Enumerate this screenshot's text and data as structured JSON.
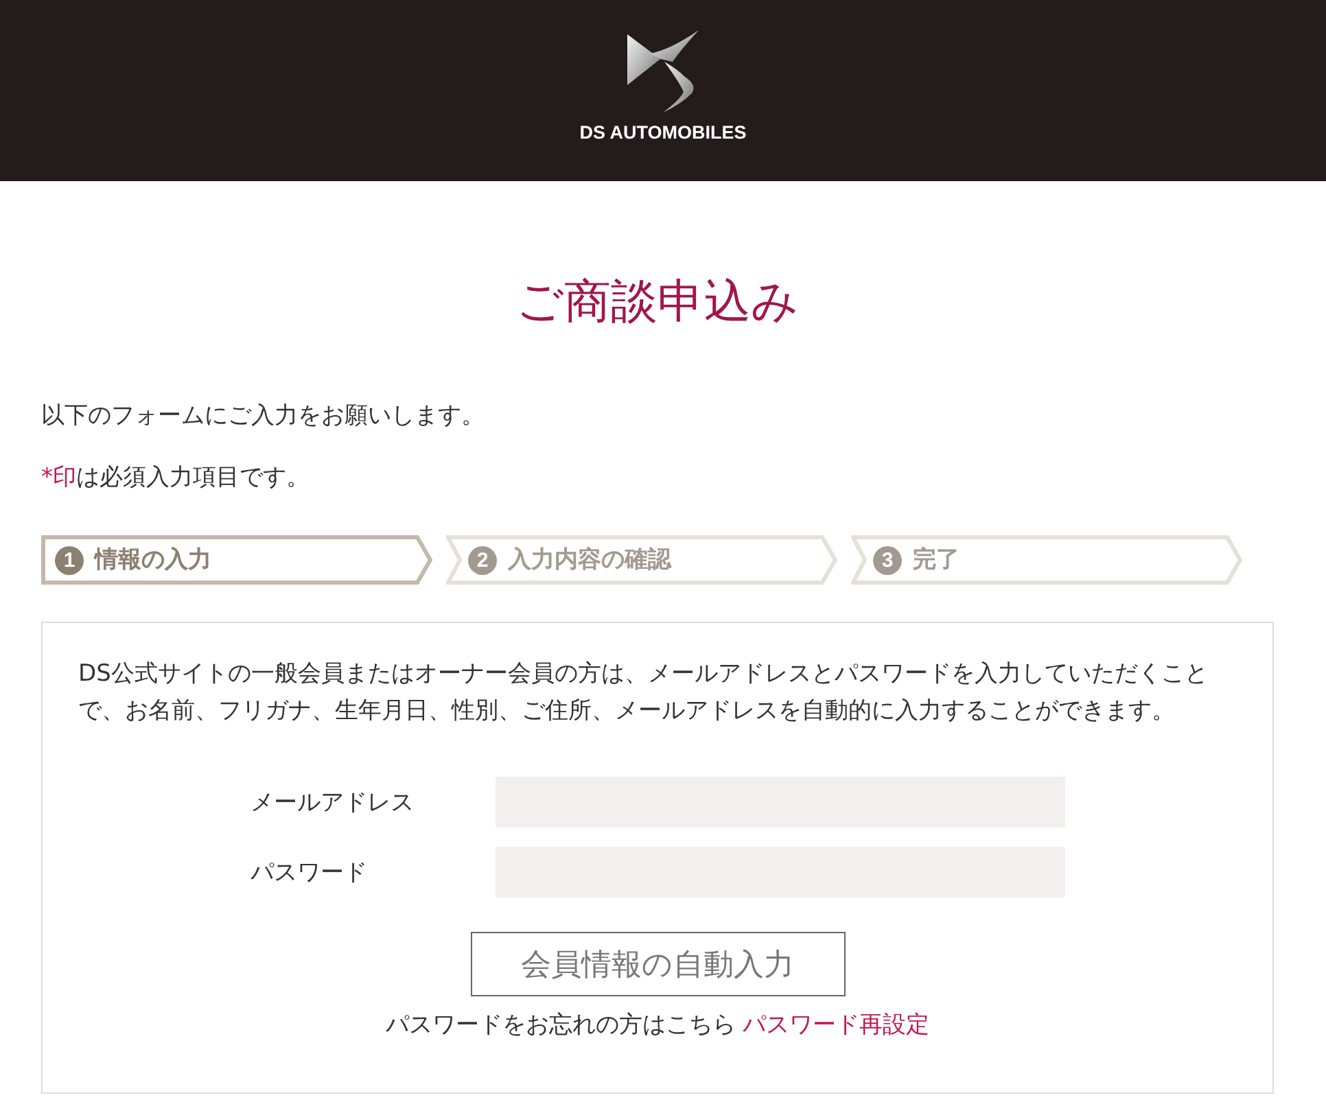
{
  "header": {
    "brand": "DS AUTOMOBILES"
  },
  "title": "ご商談申込み",
  "intro": "以下のフォームにご入力をお願いします。",
  "required_note": {
    "mark": "*印",
    "text": "は必須入力項目です。"
  },
  "steps": [
    {
      "number": "1",
      "label": "情報の入力",
      "selected": true
    },
    {
      "number": "2",
      "label": "入力内容の確認",
      "selected": false
    },
    {
      "number": "3",
      "label": "完了",
      "selected": false
    }
  ],
  "member_box": {
    "description": "DS公式サイトの一般会員またはオーナー会員の方は、メールアドレスとパスワードを入力していただくことで、お名前、フリガナ、生年月日、性別、ご住所、メールアドレスを自動的に入力することができます。",
    "fields": [
      {
        "label": "メールアドレス"
      },
      {
        "label": "パスワード"
      }
    ],
    "autofill_button": "会員情報の自動入力",
    "forgot_text": "パスワードをお忘れの方はこちら",
    "reset_link": "パスワード再設定"
  }
}
